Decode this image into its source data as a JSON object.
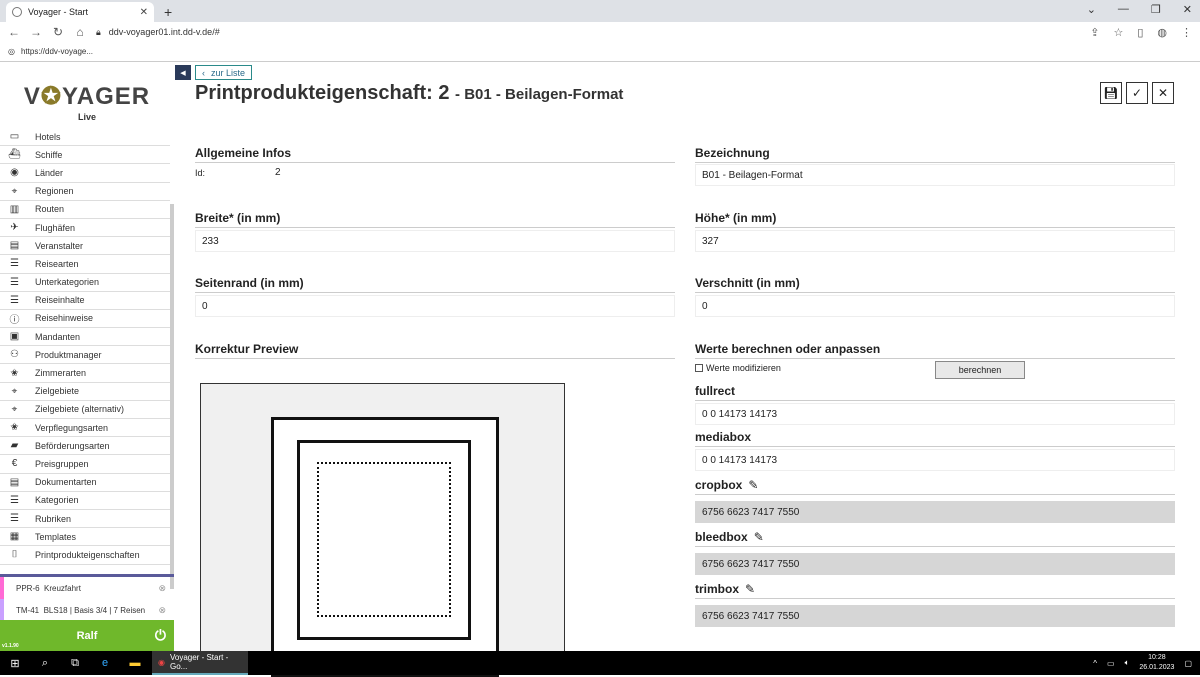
{
  "browser": {
    "tab_title": "Voyager - Start",
    "url": "ddv-voyager01.int.dd-v.de/#",
    "bookmark": "https://ddv-voyage..."
  },
  "sidebar": {
    "logo_left": "V",
    "logo_right": "YAGER",
    "logo_sub": "Live",
    "items": [
      {
        "label": "Hotels",
        "icon": "bed-icon",
        "glyph": "▭"
      },
      {
        "label": "Schiffe",
        "icon": "ship-icon",
        "glyph": "⛴"
      },
      {
        "label": "Länder",
        "icon": "globe-icon",
        "glyph": "◉"
      },
      {
        "label": "Regionen",
        "icon": "pin-icon",
        "glyph": "⌖"
      },
      {
        "label": "Routen",
        "icon": "map-icon",
        "glyph": "▥"
      },
      {
        "label": "Flughäfen",
        "icon": "plane-icon",
        "glyph": "✈"
      },
      {
        "label": "Veranstalter",
        "icon": "document-icon",
        "glyph": "▤"
      },
      {
        "label": "Reisearten",
        "icon": "list-icon",
        "glyph": "☰"
      },
      {
        "label": "Unterkategorien",
        "icon": "list-icon",
        "glyph": "☰"
      },
      {
        "label": "Reiseinhalte",
        "icon": "list-icon",
        "glyph": "☰"
      },
      {
        "label": "Reisehinweise",
        "icon": "info-icon",
        "glyph": "ⓘ"
      },
      {
        "label": "Mandanten",
        "icon": "id-card-icon",
        "glyph": "▣"
      },
      {
        "label": "Produktmanager",
        "icon": "users-icon",
        "glyph": "⚇"
      },
      {
        "label": "Zimmerarten",
        "icon": "star-icon",
        "glyph": "✬"
      },
      {
        "label": "Zielgebiete",
        "icon": "pin-icon",
        "glyph": "⌖"
      },
      {
        "label": "Zielgebiete (alternativ)",
        "icon": "pin-icon",
        "glyph": "⌖"
      },
      {
        "label": "Verpflegungsarten",
        "icon": "star-icon",
        "glyph": "✬"
      },
      {
        "label": "Beförderungsarten",
        "icon": "bus-icon",
        "glyph": "▰"
      },
      {
        "label": "Preisgruppen",
        "icon": "euro-icon",
        "glyph": "€"
      },
      {
        "label": "Dokumentarten",
        "icon": "document-icon",
        "glyph": "▤"
      },
      {
        "label": "Kategorien",
        "icon": "list-icon",
        "glyph": "☰"
      },
      {
        "label": "Rubriken",
        "icon": "list-icon",
        "glyph": "☰"
      },
      {
        "label": "Templates",
        "icon": "template-icon",
        "glyph": "▦"
      },
      {
        "label": "Printprodukteigenschaften",
        "icon": "frame-icon",
        "glyph": "⌷"
      }
    ],
    "open_tabs": [
      {
        "code": "PPR-6",
        "label": "Kreuzfahrt"
      },
      {
        "code": "TM-41",
        "label": "BLS18 | Basis 3/4 | 7 Reisen"
      }
    ],
    "user": "Ralf",
    "version": "v1.1.90"
  },
  "page": {
    "back_label": "zur Liste",
    "title": "Printprodukteigenschaft: 2",
    "subtitle": "- B01 - Beilagen-Format"
  },
  "form": {
    "allgemein_title": "Allgemeine Infos",
    "id_label": "Id:",
    "id_value": "2",
    "bezeichnung_title": "Bezeichnung",
    "bezeichnung_value": "B01 - Beilagen-Format",
    "breite_title": "Breite* (in mm)",
    "breite_value": "233",
    "hoehe_title": "Höhe* (in mm)",
    "hoehe_value": "327",
    "seitenrand_title": "Seitenrand (in mm)",
    "seitenrand_value": "0",
    "verschnitt_title": "Verschnitt (in mm)",
    "verschnitt_value": "0",
    "preview_title": "Korrektur Preview",
    "werte_title": "Werte berechnen oder anpassen",
    "modify_label": "Werte modifizieren",
    "calc_label": "berechnen",
    "fullrect_title": "fullrect",
    "fullrect_value": "0 0 14173 14173",
    "mediabox_title": "mediabox",
    "mediabox_value": "0 0 14173 14173",
    "cropbox_title": "cropbox",
    "cropbox_value": "6756 6623 7417 7550",
    "bleedbox_title": "bleedbox",
    "bleedbox_value": "6756 6623 7417 7550",
    "trimbox_title": "trimbox",
    "trimbox_value": "6756 6623 7417 7550"
  },
  "taskbar": {
    "app_label": "Voyager - Start - Go...",
    "time": "10:28",
    "date": "26.01.2023"
  }
}
